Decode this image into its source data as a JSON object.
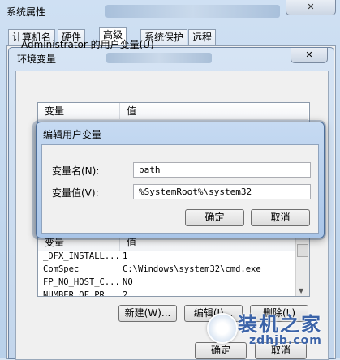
{
  "system_properties": {
    "title": "系统属性",
    "tabs": [
      "计算机名",
      "硬件",
      "高级",
      "系统保护",
      "远程"
    ],
    "ok_label": "确定",
    "cancel_label": "取消"
  },
  "env_window": {
    "title": "环境变量",
    "user_vars_label": "Administrator 的用户变量(U)",
    "table_headers": [
      "变量",
      "值"
    ],
    "system_vars_headers": [
      "变量",
      "值"
    ],
    "system_vars": [
      {
        "name": "_DFX_INSTALL...",
        "value": "1"
      },
      {
        "name": "ComSpec",
        "value": "C:\\Windows\\system32\\cmd.exe"
      },
      {
        "name": "FP_NO_HOST_C...",
        "value": "NO"
      },
      {
        "name": "NUMBER_OF_PR...",
        "value": "2"
      }
    ],
    "buttons": {
      "new": "新建(W)...",
      "edit": "编辑(I)...",
      "delete": "删除(L)"
    }
  },
  "edit_dialog": {
    "title": "编辑用户变量",
    "name_label": "变量名(N):",
    "name_value": "path",
    "value_label": "变量值(V):",
    "value_value": "%SystemRoot%\\system32",
    "ok_label": "确定",
    "cancel_label": "取消"
  },
  "watermark": {
    "text": "装机之家",
    "url": "zdhjb.com"
  }
}
